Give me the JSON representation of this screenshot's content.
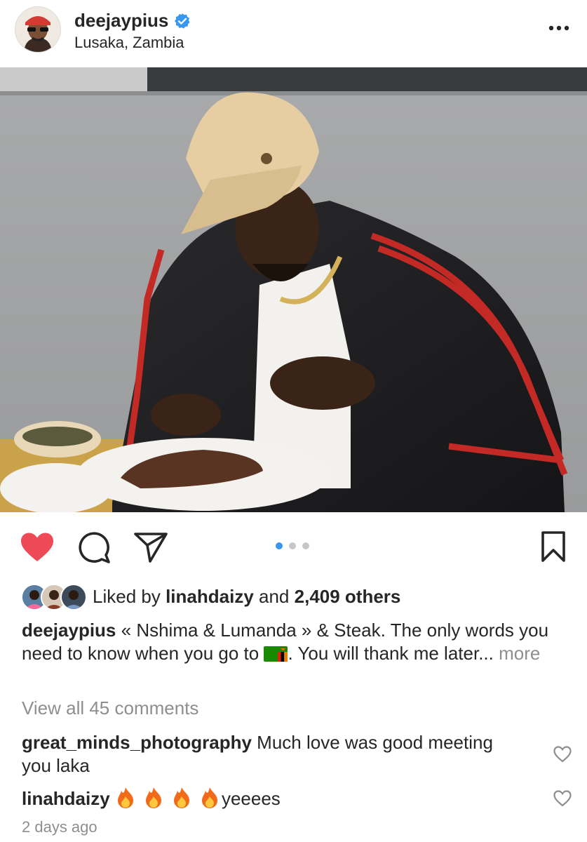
{
  "post": {
    "username": "deejaypius",
    "location": "Lusaka, Zambia",
    "icons": {
      "verified": "verified-badge-icon",
      "more": "more-options-icon"
    }
  },
  "photo": {
    "description_icon": "post-photo"
  },
  "actions": {
    "icons": [
      "heart-filled-icon",
      "comment-icon",
      "share-icon",
      "bookmark-icon"
    ],
    "carousel": {
      "count": 3,
      "active": 1
    },
    "colors": {
      "like": "#ed4956",
      "active_dot": "#3897f0"
    }
  },
  "likes": {
    "prefix": "Liked by",
    "user": "linahdaizy",
    "middle": "and",
    "count": "2,409 others"
  },
  "caption": {
    "username": "deejaypius",
    "text_part1": "« Nshima & Lumanda » & Steak. The only words you need to know when you go to",
    "text_part2": ". You will thank me later...",
    "more": "more",
    "flag_icon": "zambia-flag-icon"
  },
  "view_all": "View all 45 comments",
  "comments": [
    {
      "username": "great_minds_photography",
      "text": "Much love was good meeting you laka"
    },
    {
      "username": "linahdaizy",
      "text": "yeeees",
      "emoji_count": 4,
      "emoji_icon": "fire-icon"
    }
  ],
  "timestamp": "2 days ago"
}
